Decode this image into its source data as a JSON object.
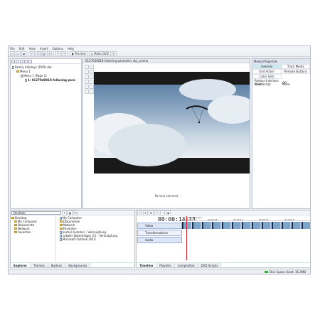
{
  "menu": [
    "File",
    "Edit",
    "View",
    "Insert",
    "Options",
    "Help"
  ],
  "toolbar": {
    "preview_label": "Preview",
    "make_dvd_label": "Make DVD",
    "auto_label": "Auto"
  },
  "tree": {
    "root": "Family holidays (DVD).dar",
    "menu1": "Menu 1",
    "menu1_page": "Menu 1 (Page 1)",
    "clip": "1: 0127040818-falloeing para"
  },
  "preview": {
    "title": "0127040818-falloeing-paraseiler sky_promo",
    "status": "No text selected"
  },
  "properties": {
    "header": "Media Properties",
    "tabs": [
      "General",
      "Track Media",
      "End Action",
      "Remote Buttons",
      "Color Sets"
    ],
    "rows": [
      [
        "Reduce Interlace flicker",
        "Off"
      ],
      [
        "Start Script",
        "None"
      ]
    ]
  },
  "explorer": {
    "location": "Desktop",
    "tree": [
      "Desktop",
      "My Computer",
      "Dokumente",
      "Network",
      "Favoriten"
    ],
    "files": [
      "My Computer",
      "Dokumente",
      "Network",
      "Favoriten",
      "kachel-hummer - Verknüpfung",
      "Lokaler Datenträger (C) - Verknüpfung",
      "Microsoft Outlook 2010"
    ],
    "tabs": [
      "Explorer",
      "Themes",
      "Buttons",
      "Backgrounds"
    ]
  },
  "timeline": {
    "timecode": "00:00:14:13",
    "scene_label": "1: Scene/Chapter",
    "ruler_ticks": [
      "00:00:00",
      "00:00:05",
      "00:00:10",
      "00:00:15",
      "00:00:20"
    ],
    "tracks": [
      "Video",
      "Transformations",
      "Audio"
    ],
    "tabs": [
      "Timeline",
      "Playlists",
      "Compilation",
      "DVD Scripts"
    ]
  },
  "status": {
    "disk_space": "Disc Space Used: 16.2MB",
    "disk_fraction": 0.05
  }
}
